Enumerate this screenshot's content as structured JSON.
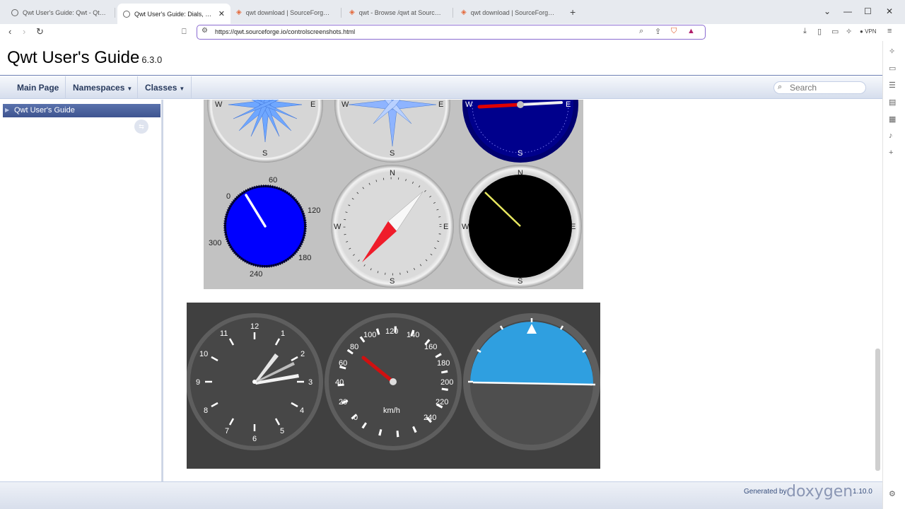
{
  "browser": {
    "tabs": [
      {
        "title": "Qwt User's Guide: Qwt - Qt Widgets",
        "icon": "globe-icon",
        "active": false
      },
      {
        "title": "Qwt User's Guide: Dials, Comp",
        "icon": "globe-icon",
        "active": true
      },
      {
        "title": "qwt download | SourceForge.net",
        "icon": "sourceforge-icon",
        "active": false
      },
      {
        "title": "qwt - Browse /qwt at SourceForge.n",
        "icon": "sourceforge-icon",
        "active": false
      },
      {
        "title": "qwt download | SourceForge.net",
        "icon": "sourceforge-icon",
        "active": false
      }
    ],
    "url": "https://qwt.sourceforge.io/controlscreenshots.html",
    "vpn_label": "VPN",
    "accent": "#8a6bd1"
  },
  "page": {
    "project_name": "Qwt User's Guide",
    "project_version": "6.3.0",
    "menu": {
      "main_page": "Main Page",
      "namespaces": "Namespaces",
      "classes": "Classes"
    },
    "search_placeholder": "Search",
    "nav_tree": {
      "item": "Qwt User's Guide"
    },
    "footer": {
      "generated_by": "Generated by",
      "tool": "doxygen",
      "version": "1.10.0"
    }
  },
  "screenshot1": {
    "compass_labels": {
      "w": "W",
      "e": "E",
      "s": "S",
      "n": "N"
    },
    "dial_ticks": [
      "60",
      "0",
      "120",
      "300",
      "180",
      "240"
    ],
    "colors": {
      "blue_dial": "#0000ff",
      "navy_dial": "#000090",
      "needle_red": "#e00000",
      "needle_yellow": "#e8e860"
    }
  },
  "screenshot2": {
    "clock_numbers": [
      "12",
      "1",
      "2",
      "3",
      "4",
      "5",
      "6",
      "7",
      "8",
      "9",
      "10",
      "11"
    ],
    "speedo_numbers": [
      "0",
      "20",
      "40",
      "60",
      "80",
      "100",
      "120",
      "140",
      "160",
      "180",
      "200",
      "220",
      "240"
    ],
    "speedo_unit": "km/h",
    "colors": {
      "sky": "#2f9fe0",
      "needle": "#d01010"
    }
  }
}
